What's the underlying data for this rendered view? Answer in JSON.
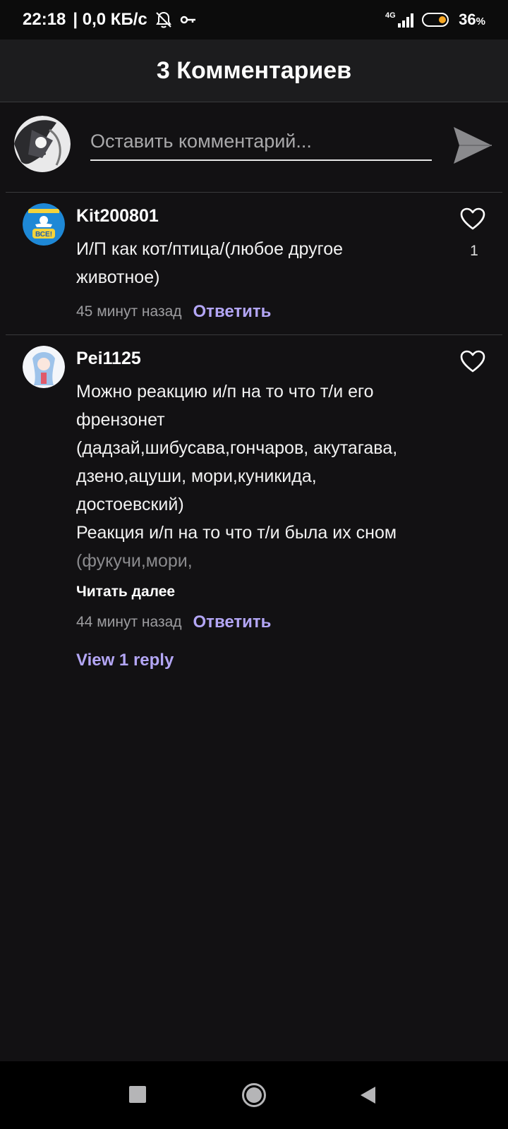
{
  "status_bar": {
    "time": "22:18",
    "speed": "| 0,0 КБ/с",
    "network": "4G",
    "battery_percent": "36",
    "battery_unit": "%"
  },
  "header": {
    "title": "3 Комментариев"
  },
  "composer": {
    "placeholder": "Оставить комментарий..."
  },
  "comments": [
    {
      "username": "Kit200801",
      "lines": [
        "И/П как кот/птица/(любое другое",
        "животное)"
      ],
      "time": "45 минут назад",
      "reply_label": "Ответить",
      "likes": "1",
      "avatar_text": "ВСЕ!"
    },
    {
      "username": "Pei1125",
      "lines": [
        "Можно реакцию и/п на то что т/и его",
        "френзонет",
        "(дадзай,шибусава,гончаров, акутагава,",
        "дзено,ацуши, мори,куникида,",
        "достоевский)",
        "Реакция и/п на то что т/и была их сном",
        "(фукучи,мори,"
      ],
      "read_more": "Читать далее",
      "time": "44 минут назад",
      "reply_label": "Ответить",
      "view_replies": "View 1 reply"
    }
  ],
  "colors": {
    "background": "#121113",
    "accent": "#b3a6f5",
    "header_bg": "#1c1c1e"
  }
}
